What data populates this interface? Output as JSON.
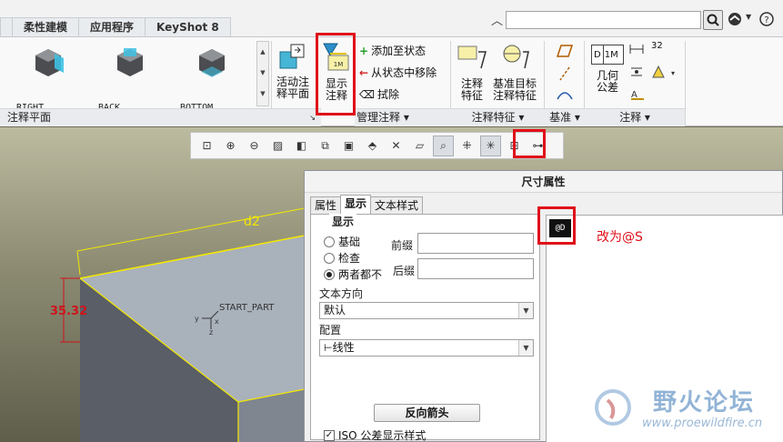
{
  "menu": {
    "tabs": [
      "柔性建模",
      "应用程序",
      "KeyShot 8"
    ]
  },
  "search": {
    "placeholder": ""
  },
  "ribbon": {
    "views": [
      {
        "label": "RIGHT"
      },
      {
        "label": "BACK"
      },
      {
        "label": "BOTTOM"
      }
    ],
    "activate_annotation_plane": "活动注\n释平面",
    "show_annotation": "显示\n注释",
    "add_to_state": "添加至状态",
    "remove_from_state": "从状态中移除",
    "erase": "拭除",
    "annotation_feature": "注释\n特征",
    "datum_target_feature": "基准目标\n注释特征",
    "geometric_tolerance": "几何\n公差",
    "geometric_tolerance_box": "1M",
    "geometric_tolerance_box_prefix": "D",
    "dimension_small": "32",
    "group_labels": {
      "annotation_plane": "注释平面",
      "manage_annotation": "管理注释",
      "annotation_feature": "注释特征",
      "datum": "基准",
      "annotation": "注释"
    }
  },
  "model": {
    "dimension_d2": "d2",
    "dimension_value": "35.32",
    "csys_label": "START_PART",
    "csys_axes": {
      "y": "y",
      "x": "x",
      "z": "z"
    }
  },
  "dialog": {
    "title": "尺寸属性",
    "tabs": [
      "属性",
      "显示",
      "文本样式"
    ],
    "active_tab": "显示",
    "section_display": "显示",
    "radios": [
      {
        "label": "基础",
        "selected": false
      },
      {
        "label": "检查",
        "selected": false
      },
      {
        "label": "两者都不",
        "selected": true
      }
    ],
    "prefix_label": "前缀",
    "suffix_label": "后缀",
    "prefix_value": "",
    "suffix_value": "",
    "text_direction_label": "文本方向",
    "text_direction_value": "默认",
    "placement_label": "配置",
    "placement_value": "线性",
    "flip_arrows_button": "反向箭头",
    "iso_checkbox_label": "ISO 公差显示样式",
    "iso_checked": true,
    "dim_symbol": "@D"
  },
  "annotation_note": "改为@S",
  "watermark": {
    "name": "野火论坛",
    "url": "www.proewildfire.cn"
  },
  "colors": {
    "highlight_red": "#e0101a",
    "dimension_yellow": "#f5e800",
    "dimension_red": "#d0131c",
    "watermark_blue": "#7fa7cf"
  }
}
